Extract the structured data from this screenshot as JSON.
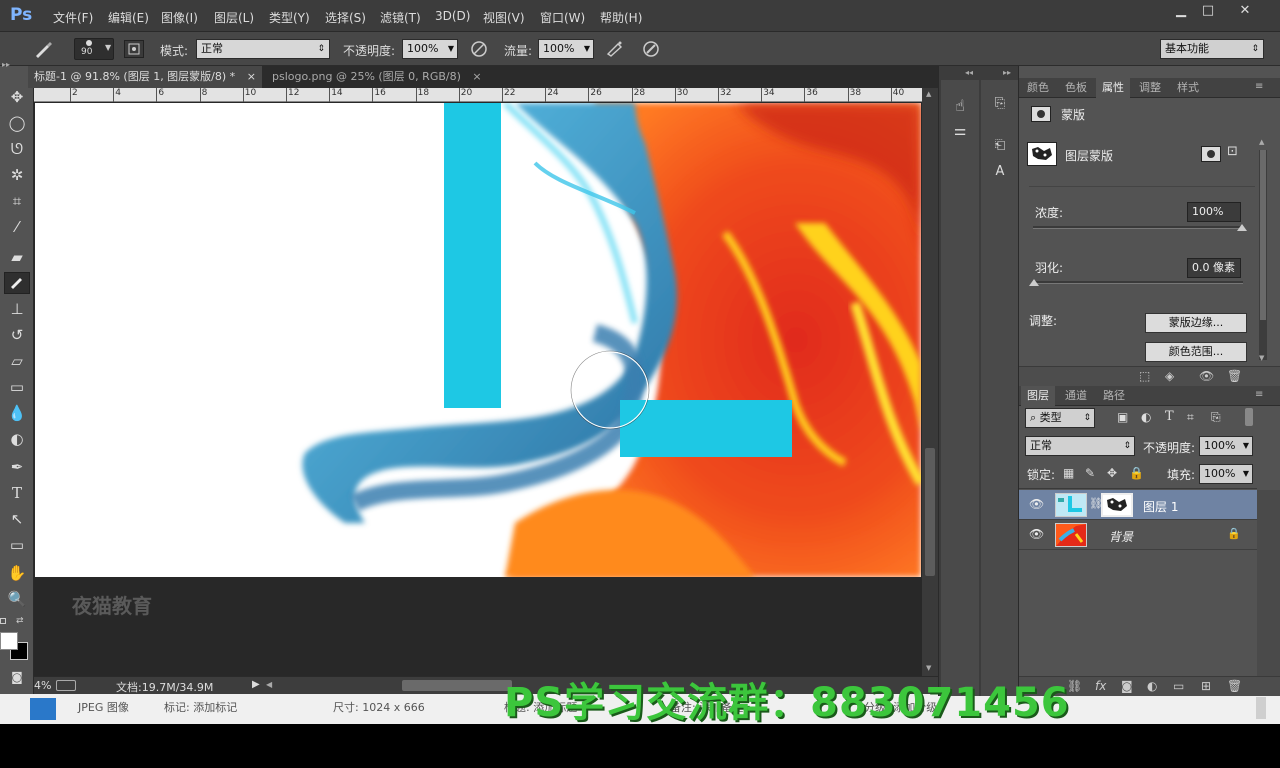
{
  "app": {
    "logo": "Ps"
  },
  "menu": [
    "文件(F)",
    "编辑(E)",
    "图像(I)",
    "图层(L)",
    "类型(Y)",
    "选择(S)",
    "滤镜(T)",
    "3D(D)",
    "视图(V)",
    "窗口(W)",
    "帮助(H)"
  ],
  "window_controls": {
    "minimize": "▁",
    "maximize": "□",
    "close": "✕"
  },
  "options": {
    "brush_size": "90",
    "mode_label": "模式:",
    "mode_value": "正常",
    "opacity_label": "不透明度:",
    "opacity_value": "100%",
    "flow_label": "流量:",
    "flow_value": "100%",
    "workspace": "基本功能"
  },
  "tabs": [
    {
      "label": "标题-1 @ 91.8% (图层 1, 图层蒙版/8) *",
      "close": "×"
    },
    {
      "label": "pslogo.png @ 25% (图层 0, RGB/8)",
      "close": "×"
    }
  ],
  "ruler_labels": [
    "2",
    "4",
    "6",
    "8",
    "10",
    "12",
    "14",
    "16",
    "18",
    "20",
    "22",
    "24",
    "26",
    "28",
    "30",
    "32",
    "34",
    "36",
    "38",
    "40"
  ],
  "canvas": {
    "logo_text": "夜猫教育"
  },
  "status": {
    "zoom": "4%",
    "doc_info": "文档:19.7M/34.9M"
  },
  "bottom_strip": {
    "type": "JPEG 图像",
    "tags": "标记: 添加标记",
    "size": "尺寸: 1024 x 666",
    "extra1": "标题: 添加标题",
    "extra2": "备注: 添加备注",
    "extra3": "分级: 添加分级"
  },
  "watermark": "PS学习交流群：883071456",
  "properties": {
    "tabs": [
      "颜色",
      "色板",
      "属性",
      "调整",
      "样式"
    ],
    "active_tab": "属性",
    "title": "蒙版",
    "layer_mask_label": "图层蒙版",
    "density_label": "浓度:",
    "density_value": "100%",
    "feather_label": "羽化:",
    "feather_value": "0.0 像素",
    "adjust_label": "调整:",
    "mask_edge_button": "蒙版边缘...",
    "color_range_button": "颜色范围..."
  },
  "layers_panel": {
    "tabs": [
      "图层",
      "通道",
      "路径"
    ],
    "filter_kind": "类型",
    "blend_mode": "正常",
    "opacity_label": "不透明度:",
    "opacity_value": "100%",
    "lock_label": "锁定:",
    "fill_label": "填充:",
    "fill_value": "100%",
    "layers": [
      {
        "name": "图层 1",
        "selected": true
      },
      {
        "name": "背景",
        "selected": false
      }
    ]
  },
  "colors": {
    "accent_cyan": "#1ec8e4",
    "selected_layer": "#6f83a3",
    "watermark_green": "#3cc63c"
  }
}
